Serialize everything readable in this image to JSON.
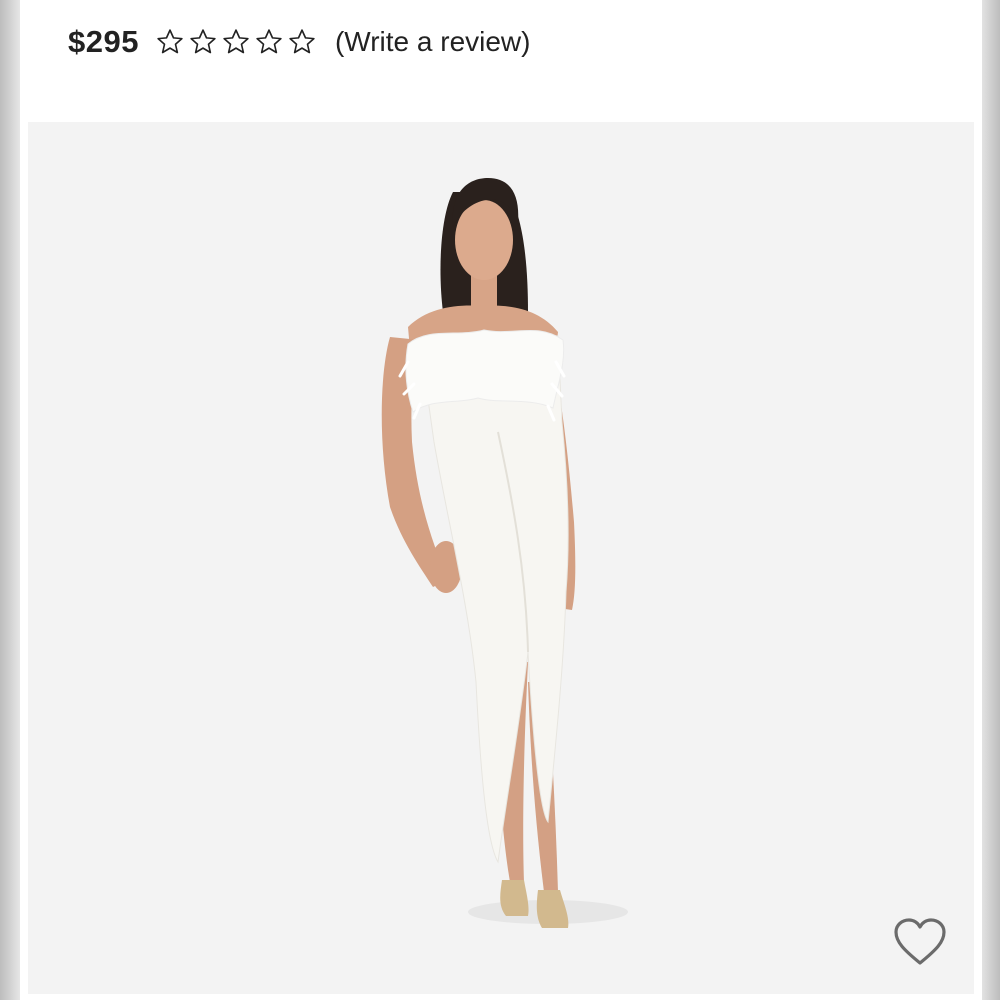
{
  "product": {
    "price": "$295",
    "rating": {
      "stars_total": 5,
      "stars_filled": 0,
      "star_icon": "star-outline-icon"
    },
    "review_link": "(Write a review)"
  },
  "image": {
    "alt": "Model wearing white strapless feather-trim maxi dress with front slit and gold strappy sandals"
  },
  "actions": {
    "favorite_icon": "heart-outline-icon"
  },
  "colors": {
    "text": "#222222",
    "image_bg": "#f3f3f3",
    "dress": "#f7f6f2",
    "skin": "#d9a88a",
    "hair": "#2a211d"
  }
}
